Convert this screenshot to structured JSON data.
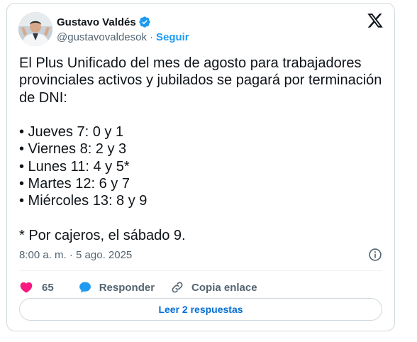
{
  "author": {
    "name": "Gustavo Valdés",
    "handle": "@gustavovaldesok",
    "separator": "·",
    "follow_label": "Seguir"
  },
  "tweet": {
    "text": "El Plus Unificado del mes de agosto para trabajadores provinciales activos y jubilados se pagará por terminación de DNI:\n\n• Jueves 7: 0 y 1\n• Viernes 8: 2 y 3\n• Lunes 11: 4 y 5*\n• Martes 12: 6 y 7\n• Miércoles 13: 8 y 9\n\n* Por cajeros, el sábado 9.",
    "timestamp": "8:00 a. m. · 5 ago. 2025"
  },
  "actions": {
    "like_count": "65",
    "reply_label": "Responder",
    "copy_label": "Copia enlace"
  },
  "replies_button": "Leer 2 respuestas",
  "colors": {
    "text": "#0f1419",
    "secondary": "#536471",
    "accent": "#1d9bf0",
    "like": "#f91880",
    "link_blue": "#006fd6",
    "border": "#cfd9de"
  },
  "icons": {
    "verified": "verified-badge-icon",
    "x_logo": "x-logo-icon",
    "info": "info-icon",
    "like": "heart-icon",
    "reply": "speech-bubble-icon",
    "copy": "link-icon"
  }
}
